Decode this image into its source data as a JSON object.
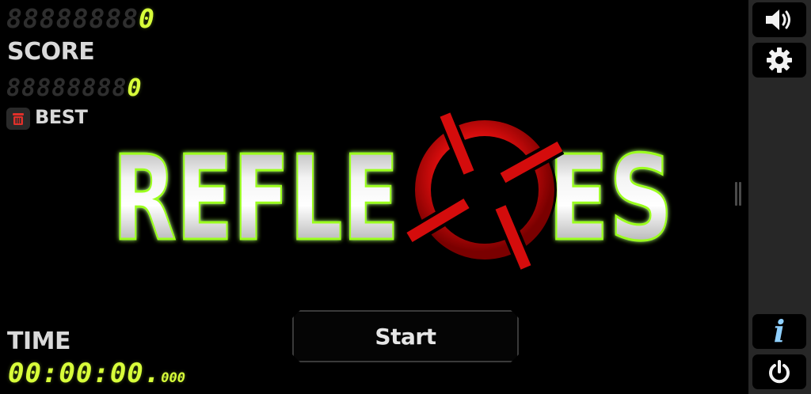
{
  "hud": {
    "score": {
      "ghost_digits": "88888888",
      "value": "0",
      "label": "SCORE"
    },
    "best": {
      "ghost_digits": "88888888",
      "value": "0",
      "label": "BEST",
      "reset_icon": "trash-icon"
    },
    "time": {
      "label": "TIME",
      "value": "00:00:00.",
      "milliseconds": "000"
    }
  },
  "logo": {
    "text_left": "REFLE",
    "text_right": "ES",
    "center_glyph": "crosshair-icon",
    "colors": {
      "letters": "#d6d6d6",
      "outline": "#9bff1e",
      "crosshair": "#d40c0c"
    }
  },
  "start_button": {
    "label": "Start"
  },
  "sidebar": {
    "buttons": [
      {
        "name": "sound",
        "icon": "speaker-icon"
      },
      {
        "name": "settings",
        "icon": "gear-icon"
      },
      {
        "name": "info",
        "icon": "info-icon",
        "glyph": "i"
      },
      {
        "name": "power",
        "icon": "power-icon"
      }
    ]
  },
  "colors": {
    "digits": "#d8ff3a",
    "labels": "#d9d9d9",
    "sidebar": "#272727",
    "background": "#000000"
  }
}
